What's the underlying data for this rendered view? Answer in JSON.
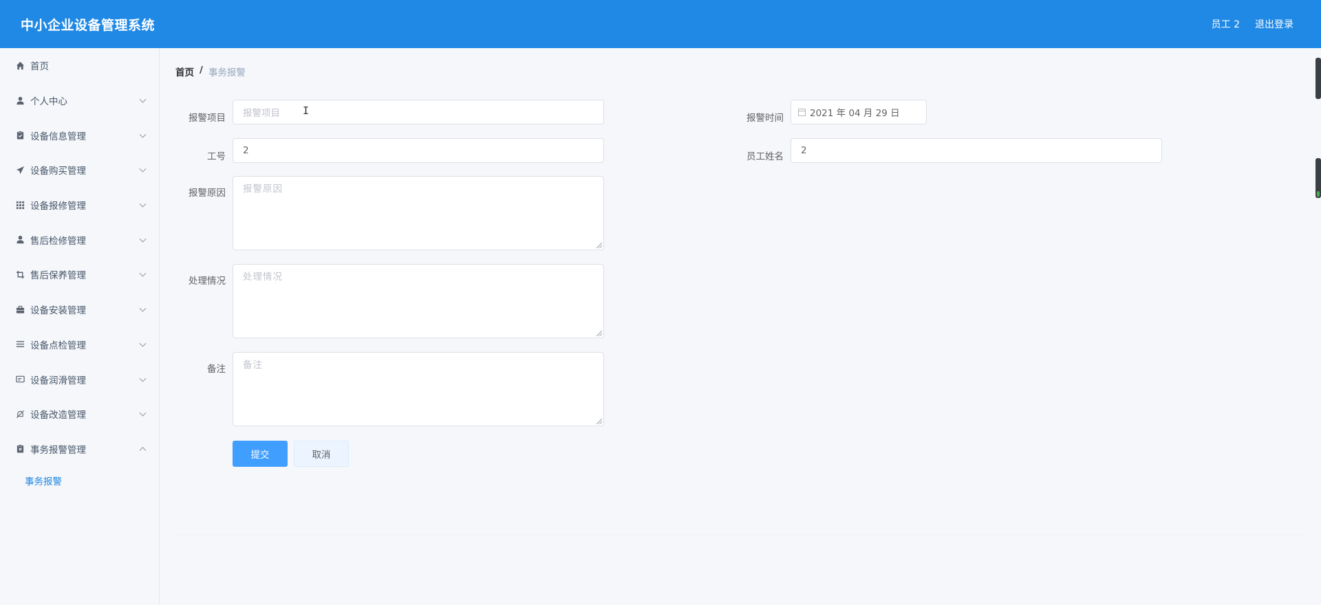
{
  "header": {
    "title": "中小企业设备管理系统",
    "user": "员工 2",
    "logout": "退出登录"
  },
  "sidebar": {
    "items": [
      {
        "label": "首页",
        "icon": "home-icon"
      },
      {
        "label": "个人中心",
        "icon": "user-icon"
      },
      {
        "label": "设备信息管理",
        "icon": "clipboard-icon"
      },
      {
        "label": "设备购买管理",
        "icon": "send-icon"
      },
      {
        "label": "设备报修管理",
        "icon": "grid-icon"
      },
      {
        "label": "售后检修管理",
        "icon": "person-icon"
      },
      {
        "label": "售后保养管理",
        "icon": "crop-icon"
      },
      {
        "label": "设备安装管理",
        "icon": "briefcase-icon"
      },
      {
        "label": "设备点检管理",
        "icon": "list-icon"
      },
      {
        "label": "设备润滑管理",
        "icon": "card-icon"
      },
      {
        "label": "设备改造管理",
        "icon": "bell-off-icon"
      },
      {
        "label": "事务报警管理",
        "icon": "clipboard-x-icon"
      }
    ],
    "sub_active": "事务报警"
  },
  "breadcrumb": {
    "home": "首页",
    "sep": "/",
    "current": "事务报警"
  },
  "form": {
    "item_label": "报警项目",
    "item_placeholder": "报警项目",
    "time_label": "报警时间",
    "time_value": "2021 年 04 月 29 日",
    "job_label": "工号",
    "job_value": "2",
    "name_label": "员工姓名",
    "name_value": "2",
    "reason_label": "报警原因",
    "reason_placeholder": "报警原因",
    "handle_label": "处理情况",
    "handle_placeholder": "处理情况",
    "note_label": "备注",
    "note_placeholder": "备注",
    "submit": "提交",
    "cancel": "取消"
  },
  "colors": {
    "header_bg": "#1f89e5",
    "primary": "#409eff",
    "active_menu": "#1f89e5"
  }
}
